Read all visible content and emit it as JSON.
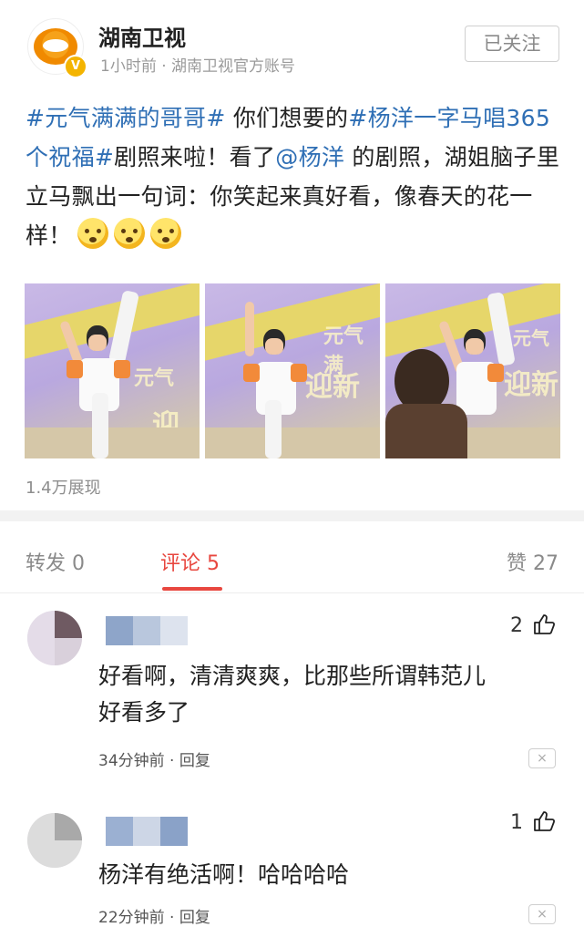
{
  "header": {
    "account_name": "湖南卫视",
    "meta": "1小时前 · 湖南卫视官方账号",
    "follow_label": "已关注",
    "verified_badge": "V"
  },
  "post": {
    "segments": [
      {
        "text": "#元气满满的哥哥#",
        "tag": true
      },
      {
        "text": " 你们想要的",
        "tag": false
      },
      {
        "text": "#杨洋一字马唱365个祝福#",
        "tag": true
      },
      {
        "text": "剧照来啦！看了",
        "tag": false
      },
      {
        "text": "@杨洋",
        "tag": true
      },
      {
        "text": " 的剧照，湖姐脑子里立马飘出一句词：你笑起来真好看，像春天的花一样！",
        "tag": false
      }
    ],
    "emoji_count": 3,
    "views": "1.4万展现",
    "photo_wall_text": [
      "元气",
      "迎新",
      "元气满",
      "迎新",
      "元气",
      "迎新"
    ]
  },
  "tabs": {
    "repost": "转发 0",
    "comment": "评论 5",
    "like": "赞 27"
  },
  "comments": [
    {
      "likes": "2",
      "text_line1": "好看啊，清清爽爽，比那些所谓韩范儿",
      "text_line2": "好看多了",
      "meta": "34分钟前 · 回复",
      "close": "×"
    },
    {
      "likes": "1",
      "text_line1": "杨洋有绝活啊！哈哈哈哈",
      "text_line2": "",
      "meta": "22分钟前 · 回复",
      "close": "×"
    }
  ],
  "colors": {
    "link": "#2f6fb5",
    "accent_red": "#e8473f",
    "meta_gray": "#9a9a9a"
  }
}
